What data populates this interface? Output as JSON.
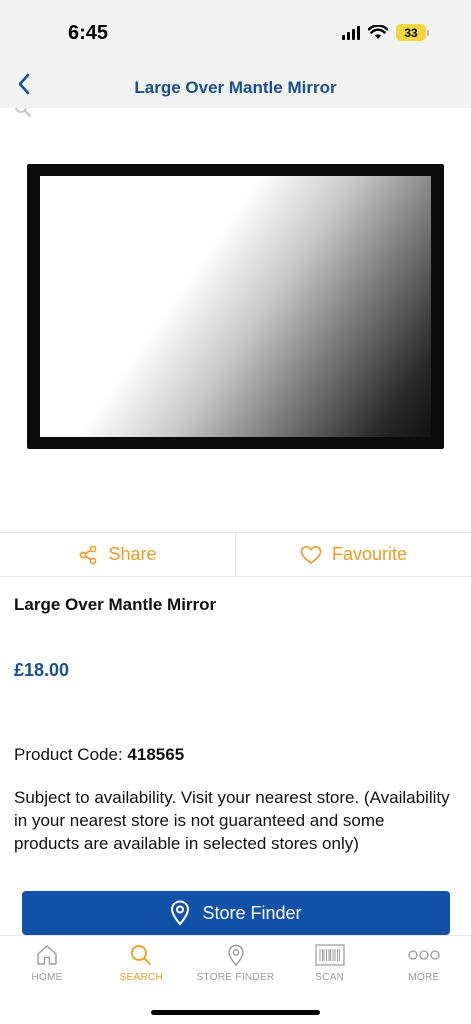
{
  "status_bar": {
    "time": "6:45",
    "battery": "33"
  },
  "nav": {
    "title": "Large Over Mantle Mirror",
    "back_icon": "chevron-left-icon"
  },
  "actions": {
    "share_label": "Share",
    "favourite_label": "Favourite"
  },
  "product": {
    "name": "Large Over Mantle Mirror",
    "price": "£18.00",
    "code_label": "Product Code:",
    "code_value": "418565",
    "availability_text": "Subject to availability. Visit your nearest store. (Availability in your nearest store is not guaranteed and some products are available in selected stores only)"
  },
  "store_finder_button": {
    "label": "Store Finder"
  },
  "tab_bar": {
    "tabs": [
      {
        "label": "HOME",
        "icon": "home-icon",
        "active": false
      },
      {
        "label": "SEARCH",
        "icon": "search-icon",
        "active": true
      },
      {
        "label": "STORE FINDER",
        "icon": "location-pin-icon",
        "active": false
      },
      {
        "label": "SCAN",
        "icon": "barcode-icon",
        "active": false
      },
      {
        "label": "MORE",
        "icon": "more-dots-icon",
        "active": false
      }
    ]
  },
  "colors": {
    "brand_blue": "#1b4f93",
    "button_blue": "#1251a8",
    "accent_orange": "#f29a1f"
  }
}
